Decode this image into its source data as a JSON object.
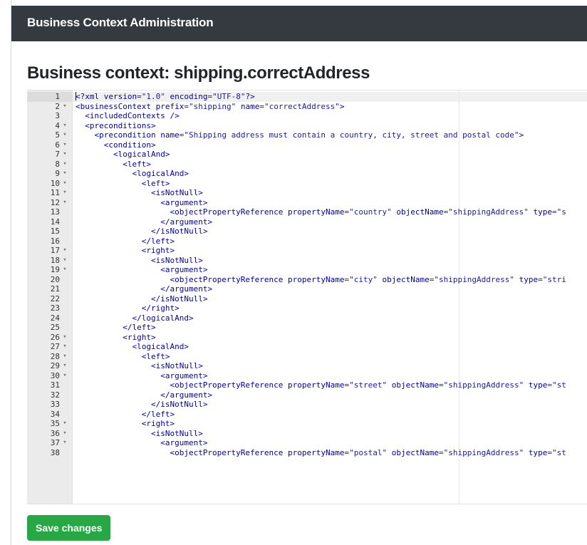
{
  "navbar": {
    "brand": "Business Context Administration"
  },
  "page": {
    "title": "Business context: shipping.correctAddress"
  },
  "editor": {
    "lines": [
      {
        "n": "1",
        "fold": "",
        "indent": 0,
        "tokens": [
          [
            "t",
            "<?"
          ],
          [
            "t",
            "xml "
          ],
          [
            "a",
            "version"
          ],
          [
            "s",
            "="
          ],
          [
            "v",
            "\"1.0\""
          ],
          [
            "s",
            " "
          ],
          [
            "a",
            "encoding"
          ],
          [
            "s",
            "="
          ],
          [
            "v",
            "\"UTF-8\""
          ],
          [
            "t",
            "?>"
          ]
        ]
      },
      {
        "n": "2",
        "fold": "▾",
        "indent": 0,
        "tokens": [
          [
            "t",
            "<businessContext "
          ],
          [
            "a",
            "prefix"
          ],
          [
            "s",
            "="
          ],
          [
            "v",
            "\"shipping\""
          ],
          [
            "s",
            " "
          ],
          [
            "a",
            "name"
          ],
          [
            "s",
            "="
          ],
          [
            "v",
            "\"correctAddress\""
          ],
          [
            "t",
            ">"
          ]
        ]
      },
      {
        "n": "3",
        "fold": "",
        "indent": 1,
        "tokens": [
          [
            "t",
            "<includedContexts />"
          ]
        ]
      },
      {
        "n": "4",
        "fold": "▾",
        "indent": 1,
        "tokens": [
          [
            "t",
            "<preconditions>"
          ]
        ]
      },
      {
        "n": "5",
        "fold": "▾",
        "indent": 2,
        "tokens": [
          [
            "t",
            "<precondition "
          ],
          [
            "a",
            "name"
          ],
          [
            "s",
            "="
          ],
          [
            "v",
            "\"Shipping address must contain a country, city, street and postal code\""
          ],
          [
            "t",
            ">"
          ]
        ]
      },
      {
        "n": "6",
        "fold": "▾",
        "indent": 3,
        "tokens": [
          [
            "t",
            "<condition>"
          ]
        ]
      },
      {
        "n": "7",
        "fold": "▾",
        "indent": 4,
        "tokens": [
          [
            "t",
            "<logicalAnd>"
          ]
        ]
      },
      {
        "n": "8",
        "fold": "▾",
        "indent": 5,
        "tokens": [
          [
            "t",
            "<left>"
          ]
        ]
      },
      {
        "n": "9",
        "fold": "▾",
        "indent": 6,
        "tokens": [
          [
            "t",
            "<logicalAnd>"
          ]
        ]
      },
      {
        "n": "10",
        "fold": "▾",
        "indent": 7,
        "tokens": [
          [
            "t",
            "<left>"
          ]
        ]
      },
      {
        "n": "11",
        "fold": "▾",
        "indent": 8,
        "tokens": [
          [
            "t",
            "<isNotNull>"
          ]
        ]
      },
      {
        "n": "12",
        "fold": "▾",
        "indent": 9,
        "tokens": [
          [
            "t",
            "<argument>"
          ]
        ]
      },
      {
        "n": "13",
        "fold": "",
        "indent": 10,
        "tokens": [
          [
            "t",
            "<objectPropertyReference "
          ],
          [
            "a",
            "propertyName"
          ],
          [
            "s",
            "="
          ],
          [
            "v",
            "\"country\""
          ],
          [
            "s",
            " "
          ],
          [
            "a",
            "objectName"
          ],
          [
            "s",
            "="
          ],
          [
            "v",
            "\"shippingAddress\""
          ],
          [
            "s",
            " "
          ],
          [
            "a",
            "type"
          ],
          [
            "s",
            "="
          ],
          [
            "v",
            "\"s"
          ]
        ]
      },
      {
        "n": "14",
        "fold": "",
        "indent": 9,
        "tokens": [
          [
            "t",
            "</argument>"
          ]
        ]
      },
      {
        "n": "15",
        "fold": "",
        "indent": 8,
        "tokens": [
          [
            "t",
            "</isNotNull>"
          ]
        ]
      },
      {
        "n": "16",
        "fold": "",
        "indent": 7,
        "tokens": [
          [
            "t",
            "</left>"
          ]
        ]
      },
      {
        "n": "17",
        "fold": "▾",
        "indent": 7,
        "tokens": [
          [
            "t",
            "<right>"
          ]
        ]
      },
      {
        "n": "18",
        "fold": "▾",
        "indent": 8,
        "tokens": [
          [
            "t",
            "<isNotNull>"
          ]
        ]
      },
      {
        "n": "19",
        "fold": "▾",
        "indent": 9,
        "tokens": [
          [
            "t",
            "<argument>"
          ]
        ]
      },
      {
        "n": "20",
        "fold": "",
        "indent": 10,
        "tokens": [
          [
            "t",
            "<objectPropertyReference "
          ],
          [
            "a",
            "propertyName"
          ],
          [
            "s",
            "="
          ],
          [
            "v",
            "\"city\""
          ],
          [
            "s",
            " "
          ],
          [
            "a",
            "objectName"
          ],
          [
            "s",
            "="
          ],
          [
            "v",
            "\"shippingAddress\""
          ],
          [
            "s",
            " "
          ],
          [
            "a",
            "type"
          ],
          [
            "s",
            "="
          ],
          [
            "v",
            "\"stri"
          ]
        ]
      },
      {
        "n": "21",
        "fold": "",
        "indent": 9,
        "tokens": [
          [
            "t",
            "</argument>"
          ]
        ]
      },
      {
        "n": "22",
        "fold": "",
        "indent": 8,
        "tokens": [
          [
            "t",
            "</isNotNull>"
          ]
        ]
      },
      {
        "n": "23",
        "fold": "",
        "indent": 7,
        "tokens": [
          [
            "t",
            "</right>"
          ]
        ]
      },
      {
        "n": "24",
        "fold": "",
        "indent": 6,
        "tokens": [
          [
            "t",
            "</logicalAnd>"
          ]
        ]
      },
      {
        "n": "25",
        "fold": "",
        "indent": 5,
        "tokens": [
          [
            "t",
            "</left>"
          ]
        ]
      },
      {
        "n": "26",
        "fold": "▾",
        "indent": 5,
        "tokens": [
          [
            "t",
            "<right>"
          ]
        ]
      },
      {
        "n": "27",
        "fold": "▾",
        "indent": 6,
        "tokens": [
          [
            "t",
            "<logicalAnd>"
          ]
        ]
      },
      {
        "n": "28",
        "fold": "▾",
        "indent": 7,
        "tokens": [
          [
            "t",
            "<left>"
          ]
        ]
      },
      {
        "n": "29",
        "fold": "▾",
        "indent": 8,
        "tokens": [
          [
            "t",
            "<isNotNull>"
          ]
        ]
      },
      {
        "n": "30",
        "fold": "▾",
        "indent": 9,
        "tokens": [
          [
            "t",
            "<argument>"
          ]
        ]
      },
      {
        "n": "31",
        "fold": "",
        "indent": 10,
        "tokens": [
          [
            "t",
            "<objectPropertyReference "
          ],
          [
            "a",
            "propertyName"
          ],
          [
            "s",
            "="
          ],
          [
            "v",
            "\"street\""
          ],
          [
            "s",
            " "
          ],
          [
            "a",
            "objectName"
          ],
          [
            "s",
            "="
          ],
          [
            "v",
            "\"shippingAddress\""
          ],
          [
            "s",
            " "
          ],
          [
            "a",
            "type"
          ],
          [
            "s",
            "="
          ],
          [
            "v",
            "\"st"
          ]
        ]
      },
      {
        "n": "32",
        "fold": "",
        "indent": 9,
        "tokens": [
          [
            "t",
            "</argument>"
          ]
        ]
      },
      {
        "n": "33",
        "fold": "",
        "indent": 8,
        "tokens": [
          [
            "t",
            "</isNotNull>"
          ]
        ]
      },
      {
        "n": "34",
        "fold": "",
        "indent": 7,
        "tokens": [
          [
            "t",
            "</left>"
          ]
        ]
      },
      {
        "n": "35",
        "fold": "▾",
        "indent": 7,
        "tokens": [
          [
            "t",
            "<right>"
          ]
        ]
      },
      {
        "n": "36",
        "fold": "▾",
        "indent": 8,
        "tokens": [
          [
            "t",
            "<isNotNull>"
          ]
        ]
      },
      {
        "n": "37",
        "fold": "▾",
        "indent": 9,
        "tokens": [
          [
            "t",
            "<argument>"
          ]
        ]
      },
      {
        "n": "38",
        "fold": "",
        "indent": 10,
        "tokens": [
          [
            "t",
            "<objectPropertyReference "
          ],
          [
            "a",
            "propertyName"
          ],
          [
            "s",
            "="
          ],
          [
            "v",
            "\"postal\""
          ],
          [
            "s",
            " "
          ],
          [
            "a",
            "objectName"
          ],
          [
            "s",
            "="
          ],
          [
            "v",
            "\"shippingAddress\""
          ],
          [
            "s",
            " "
          ],
          [
            "a",
            "type"
          ],
          [
            "s",
            "="
          ],
          [
            "v",
            "\"st"
          ]
        ]
      }
    ]
  },
  "actions": {
    "save_label": "Save changes"
  },
  "colors": {
    "navbar_bg": "#343a40",
    "save_button_bg": "#28a745",
    "xml_tag": "#0000a2",
    "xml_value": "#1a1aa6"
  }
}
